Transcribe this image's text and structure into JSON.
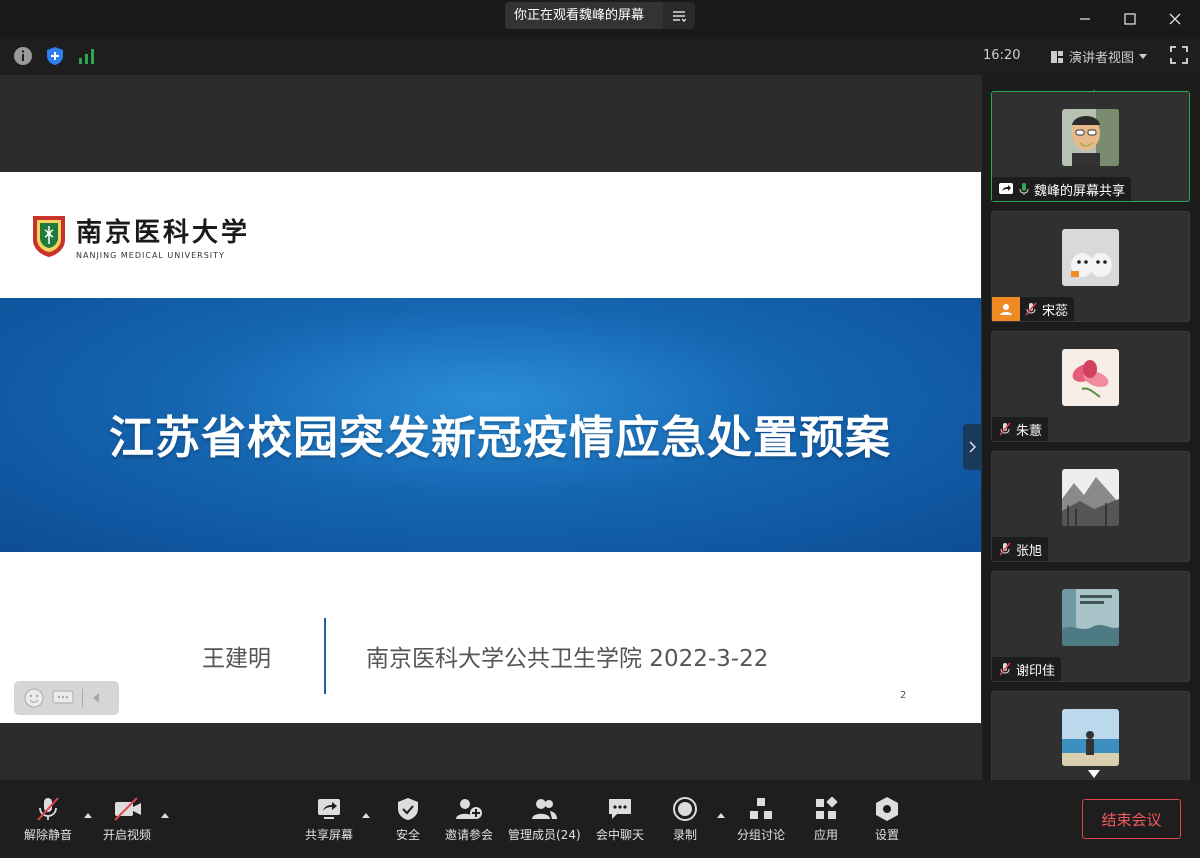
{
  "titlebar": {
    "sharing_label": "你正在观看魏峰的屏幕"
  },
  "infobar": {
    "time": "16:20",
    "view_mode": "演讲者视图"
  },
  "slide": {
    "university_cn": "南京医科大学",
    "university_en": "NANJING MEDICAL UNIVERSITY",
    "title": "江苏省校园突发新冠疫情应急处置预案",
    "author": "王建明",
    "affiliation": "南京医科大学公共卫生学院  2022-3-22",
    "page_number": "2"
  },
  "participants": [
    {
      "name": "魏峰的屏幕共享",
      "mic": "on",
      "sharing": true,
      "active": true
    },
    {
      "name": "宋蕊",
      "mic": "muted",
      "host_badge": true
    },
    {
      "name": "朱薏",
      "mic": "muted"
    },
    {
      "name": "张旭",
      "mic": "muted"
    },
    {
      "name": "谢印佳",
      "mic": "muted"
    },
    {
      "name": "",
      "mic": "muted"
    }
  ],
  "toolbar": {
    "unmute": "解除静音",
    "start_video": "开启视频",
    "share_screen": "共享屏幕",
    "security": "安全",
    "invite": "邀请参会",
    "participants": "管理成员(24)",
    "chat": "会中聊天",
    "record": "录制",
    "breakout": "分组讨论",
    "apps": "应用",
    "settings": "设置",
    "end_meeting": "结束会议"
  },
  "colors": {
    "accent_green": "#2ea84f",
    "end_red": "#e0454a",
    "slide_blue": "#1565b0"
  }
}
